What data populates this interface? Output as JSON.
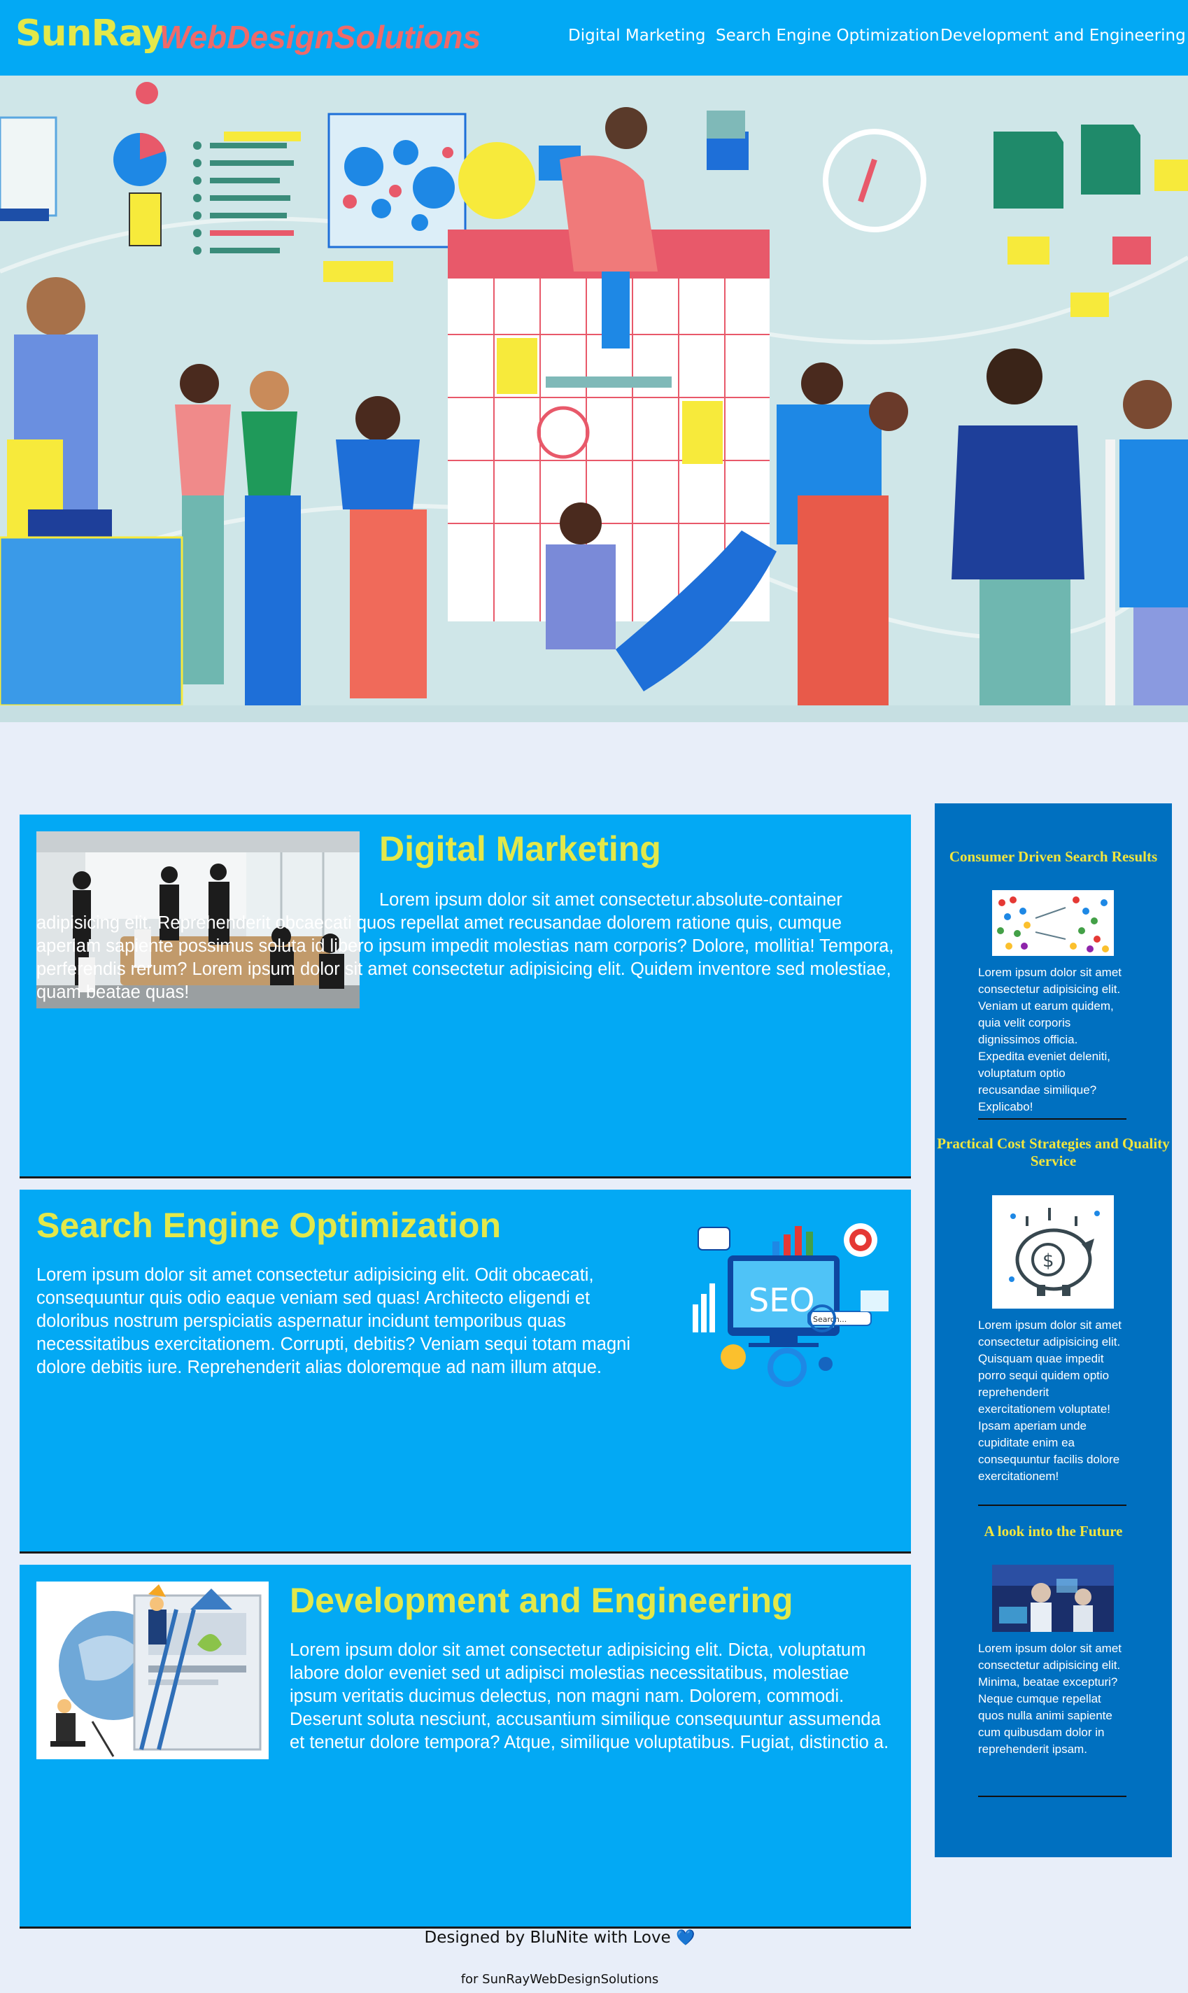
{
  "header": {
    "brand_primary": "SunRay",
    "brand_secondary": "WebDesignSolutions",
    "nav": [
      {
        "label": "Digital Marketing"
      },
      {
        "label": "Search Engine Optimization"
      },
      {
        "label": "Development and Engineering"
      }
    ]
  },
  "colors": {
    "header_bg": "#03a9f4",
    "card_bg": "#03a9f4",
    "aside_bg": "#0070c0",
    "page_bg": "#e8eef9",
    "heading_yellow": "#e3e84a",
    "brand_red": "#ee6a6a"
  },
  "hero": {
    "image": "team-planning-illustration"
  },
  "sections": [
    {
      "title": "Digital Marketing",
      "image": "office-meeting-photo",
      "body": "Lorem ipsum dolor sit amet consectetur.absolute-container adipisicing elit. Reprehenderit obcaecati quos repellat amet recusandae dolorem ratione quis, cumque aperiam sapiente possimus soluta id libero ipsum impedit molestias nam corporis? Dolore, mollitia! Tempora, perferendis rerum? Lorem ipsum dolor sit amet consectetur adipisicing elit. Quidem inventore sed molestiae, quam beatae quas!"
    },
    {
      "title": "Search Engine Optimization",
      "image": "seo-illustration",
      "seo_label": "SEO",
      "search_label": "Search...",
      "body": "Lorem ipsum dolor sit amet consectetur adipisicing elit. Odit obcaecati, consequuntur quis odio eaque veniam sed quas! Architecto eligendi et doloribus nostrum perspiciatis aspernatur incidunt temporibus quas necessitatibus exercitationem. Corrupti, debitis? Veniam sequi totam magni dolore debitis iure. Reprehenderit alias doloremque ad nam illum atque."
    },
    {
      "title": "Development and Engineering",
      "image": "engineering-illustration",
      "body": "Lorem ipsum dolor sit amet consectetur adipisicing elit. Dicta, voluptatum labore dolor eveniet sed ut adipisci molestias necessitatibus, molestiae ipsum veritatis ducimus delectus, non magni nam. Dolorem, commodi. Deserunt soluta nesciunt, accusantium similique consequuntur assumenda et tenetur dolore tempora? Atque, similique voluptatibus. Fugiat, distinctio a."
    }
  ],
  "aside": [
    {
      "title": "Consumer Driven Search Results",
      "image": "people-network-icon",
      "body": "Lorem ipsum dolor sit amet consectetur adipisicing elit. Veniam ut earum quidem, quia velit corporis dignissimos officia. Expedita eveniet deleniti, voluptatum optio recusandae similique? Explicabo!"
    },
    {
      "title": "Practical Cost Strategies and Quality Service",
      "image": "piggy-bank-icon",
      "body": "Lorem ipsum dolor sit amet consectetur adipisicing elit. Quisquam quae impedit porro sequi quidem optio reprehenderit exercitationem voluptate! Ipsam aperiam unde cupiditate enim ea consequuntur facilis dolore exercitationem!"
    },
    {
      "title": "A look into the Future",
      "image": "future-tech-photo",
      "body": "Lorem ipsum dolor sit amet consectetur adipisicing elit. Minima, beatae excepturi? Neque cumque repellat quos nulla animi sapiente cum quibusdam dolor in reprehenderit ipsam."
    }
  ],
  "footer": {
    "credit": "Designed by BluNite with Love",
    "heart_icon": "blue-heart-icon",
    "heart": "💙",
    "for_line": "for SunRayWebDesignSolutions"
  }
}
